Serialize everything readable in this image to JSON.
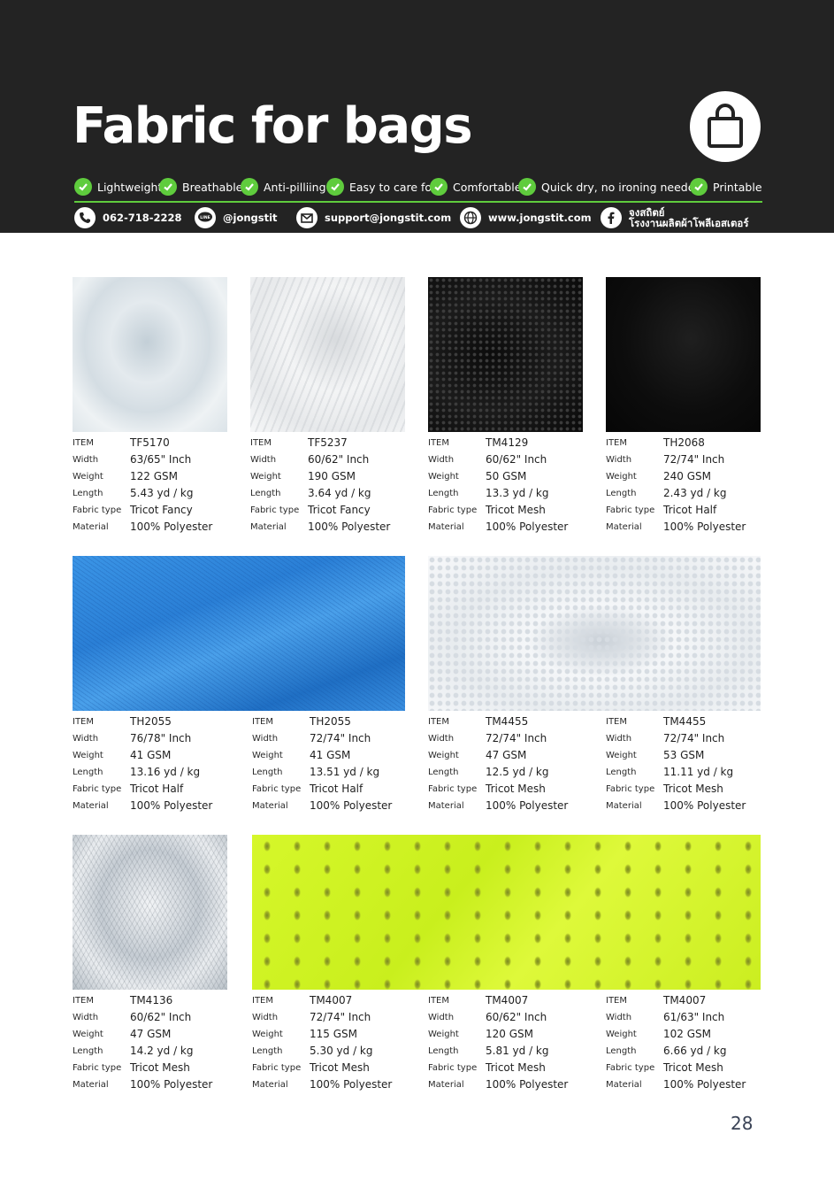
{
  "header": {
    "title": "Fabric for bags",
    "bag_icon": "shopping-bag-icon",
    "features": [
      "Lightweight",
      "Breathable",
      "Anti-pilliing",
      "Easy to care for",
      "Comfortable",
      "Quick dry, no ironing needed",
      "Printable"
    ],
    "contacts": {
      "phone": "062-718-2228",
      "line": "@jongstit",
      "email": "support@jongstit.com",
      "website": "www.jongstit.com",
      "facebook_line1": "จงสถิตย์",
      "facebook_line2": "โรงงานผลิตผ้าโพลีเอสเตอร์"
    }
  },
  "labels": {
    "item": "ITEM",
    "width": "Width",
    "weight": "Weight",
    "length": "Length",
    "fabric_type": "Fabric type",
    "material": "Material"
  },
  "colors": {
    "header_bg": "#232323",
    "accent_green": "#5fcc3d",
    "white_fabric": "#e6ebef",
    "black_fabric": "#141414",
    "blue_fabric": "#2f86dd",
    "neon_fabric": "#d0f521"
  },
  "products": [
    {
      "item": "TF5170",
      "width": "63/65\" Inch",
      "weight": "122 GSM",
      "length": "5.43 yd / kg",
      "fabric_type": "Tricot Fancy",
      "material": "100% Polyester"
    },
    {
      "item": "TF5237",
      "width": "60/62\" Inch",
      "weight": "190 GSM",
      "length": "3.64 yd / kg",
      "fabric_type": "Tricot Fancy",
      "material": "100% Polyester"
    },
    {
      "item": "TM4129",
      "width": "60/62\" Inch",
      "weight": "50 GSM",
      "length": "13.3 yd / kg",
      "fabric_type": "Tricot Mesh",
      "material": "100% Polyester"
    },
    {
      "item": "TH2068",
      "width": "72/74\" Inch",
      "weight": "240 GSM",
      "length": "2.43 yd / kg",
      "fabric_type": "Tricot Half",
      "material": "100% Polyester"
    },
    {
      "item": "TH2055",
      "width": "76/78\" Inch",
      "weight": "41 GSM",
      "length": "13.16 yd / kg",
      "fabric_type": "Tricot Half",
      "material": "100% Polyester"
    },
    {
      "item": "TH2055",
      "width": "72/74\" Inch",
      "weight": "41 GSM",
      "length": "13.51 yd / kg",
      "fabric_type": "Tricot Half",
      "material": "100% Polyester"
    },
    {
      "item": "TM4455",
      "width": "72/74\" Inch",
      "weight": "47 GSM",
      "length": "12.5 yd / kg",
      "fabric_type": "Tricot Mesh",
      "material": "100% Polyester"
    },
    {
      "item": "TM4455",
      "width": "72/74\" Inch",
      "weight": "53 GSM",
      "length": "11.11 yd / kg",
      "fabric_type": "Tricot Mesh",
      "material": "100% Polyester"
    },
    {
      "item": "TM4136",
      "width": "60/62\" Inch",
      "weight": "47 GSM",
      "length": "14.2 yd / kg",
      "fabric_type": "Tricot Mesh",
      "material": "100% Polyester"
    },
    {
      "item": "TM4007",
      "width": "72/74\" Inch",
      "weight": "115 GSM",
      "length": "5.30 yd / kg",
      "fabric_type": "Tricot  Mesh",
      "material": "100% Polyester"
    },
    {
      "item": "TM4007",
      "width": "60/62\" Inch",
      "weight": "120 GSM",
      "length": "5.81 yd / kg",
      "fabric_type": "Tricot  Mesh",
      "material": "100% Polyester"
    },
    {
      "item": "TM4007",
      "width": "61/63\" Inch",
      "weight": "102 GSM",
      "length": "6.66 yd / kg",
      "fabric_type": "Tricot  Mesh",
      "material": "100% Polyester"
    }
  ],
  "page_number": "28"
}
